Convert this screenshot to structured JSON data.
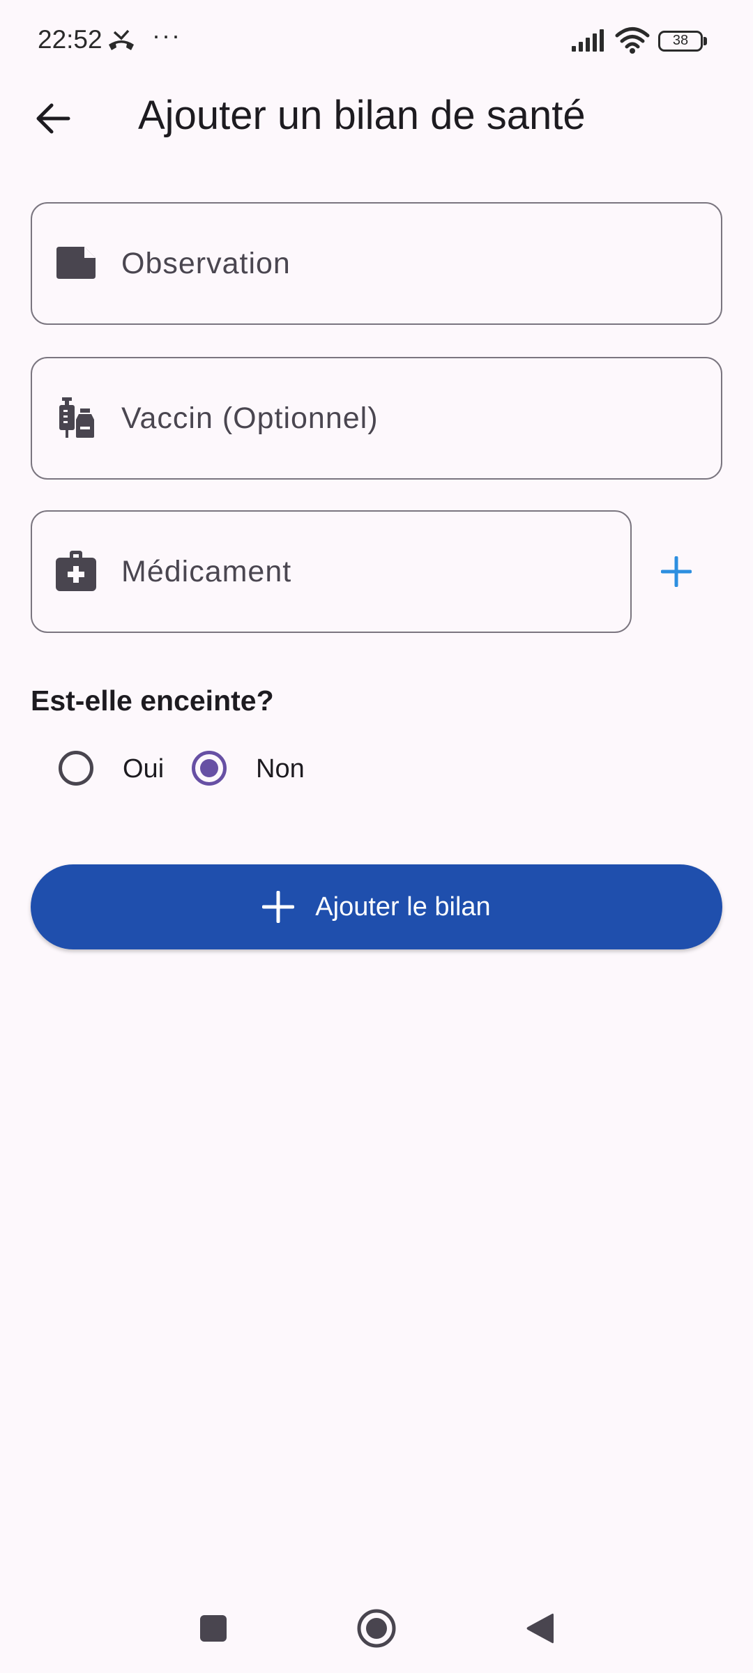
{
  "status_bar": {
    "time": "22:52",
    "more": "···",
    "battery": "38",
    "icons": [
      "missed-call-icon",
      "signal-icon",
      "wifi-icon",
      "battery-icon"
    ]
  },
  "app_bar": {
    "title": "Ajouter un bilan de santé",
    "back_icon": "arrow-back-icon"
  },
  "form": {
    "observation": {
      "placeholder": "Observation",
      "value": "",
      "icon": "note-icon"
    },
    "vaccin": {
      "placeholder": "Vaccin (Optionnel)",
      "value": "",
      "icon": "vaccine-icon"
    },
    "medicament": {
      "placeholder": "Médicament",
      "value": "",
      "icon": "medical-bag-icon"
    },
    "add_medicament_icon": "plus-icon",
    "pregnancy": {
      "question": "Est-elle enceinte?",
      "options": [
        {
          "label": "Oui",
          "selected": false
        },
        {
          "label": "Non",
          "selected": true
        }
      ]
    },
    "submit": {
      "label": "Ajouter le bilan",
      "icon": "plus-icon"
    }
  },
  "colors": {
    "background": "#fdf8fc",
    "primary_button": "#1f4fad",
    "radio_selected": "#6750a4",
    "add_icon": "#2d8fe0",
    "field_border": "#7a757f"
  },
  "nav_bar": {
    "icons": [
      "recents-icon",
      "home-icon",
      "back-icon"
    ]
  }
}
